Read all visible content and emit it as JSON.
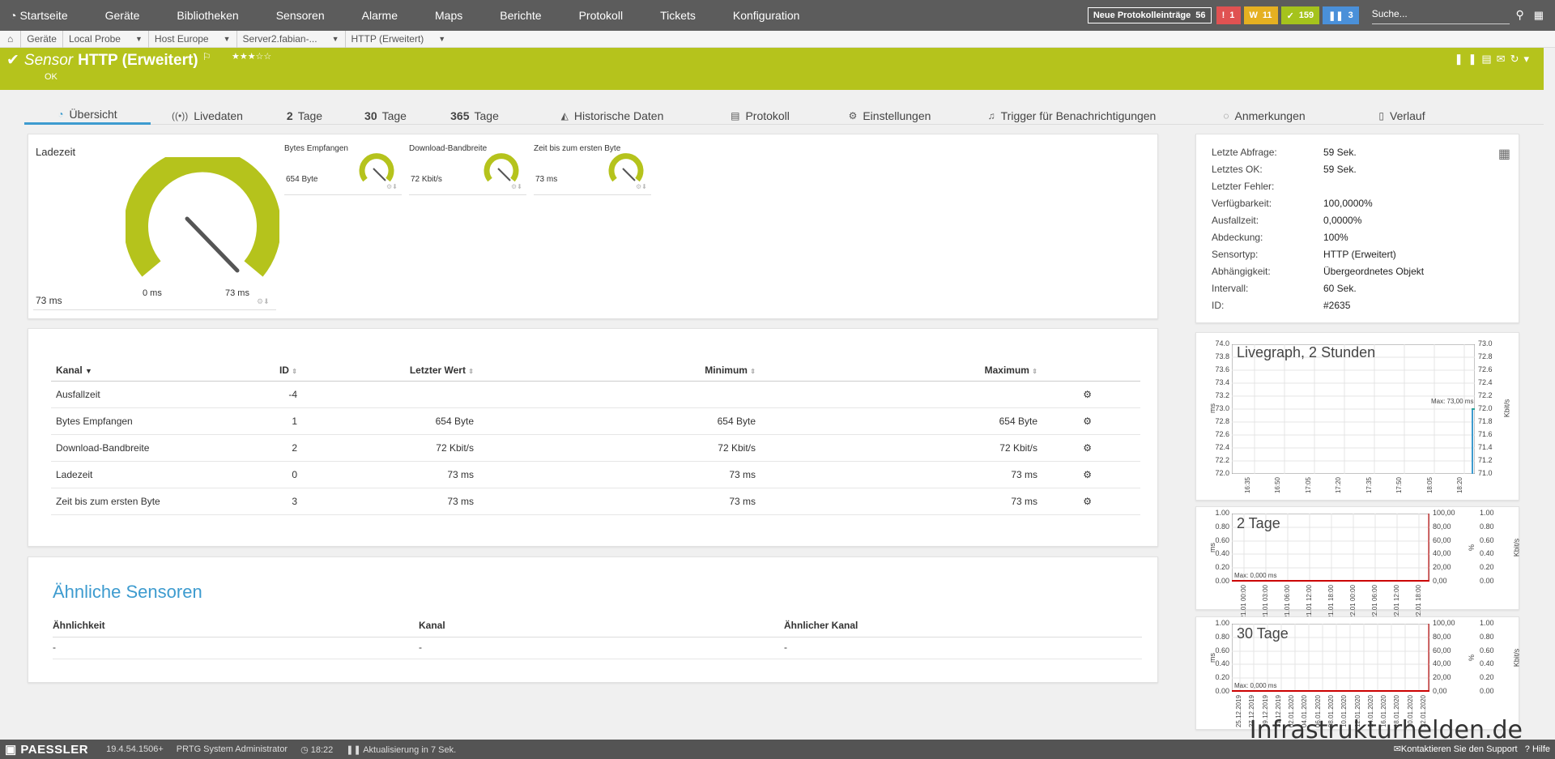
{
  "nav": {
    "items": [
      "Startseite",
      "Geräte",
      "Bibliotheken",
      "Sensoren",
      "Alarme",
      "Maps",
      "Berichte",
      "Protokoll",
      "Tickets",
      "Konfiguration"
    ],
    "new_log_label": "Neue Protokolleinträge",
    "new_log_count": "56",
    "badge_red": "1",
    "badge_yellow": "11",
    "badge_green": "159",
    "badge_blue": "3",
    "search_placeholder": "Suche..."
  },
  "breadcrumb": [
    "Geräte",
    "Local Probe",
    "Host Europe",
    "Server2.fabian-...",
    "HTTP (Erweitert)"
  ],
  "sensor": {
    "prefix": "Sensor",
    "name": "HTTP (Erweitert)",
    "status": "OK",
    "stars": "★★★☆☆"
  },
  "tabs": [
    {
      "num": "",
      "label": "Übersicht",
      "icon": "overview-icon"
    },
    {
      "num": "",
      "label": "Livedaten",
      "icon": "live-icon"
    },
    {
      "num": "2",
      "label": "Tage",
      "icon": ""
    },
    {
      "num": "30",
      "label": "Tage",
      "icon": ""
    },
    {
      "num": "365",
      "label": "Tage",
      "icon": ""
    },
    {
      "num": "",
      "label": "Historische Daten",
      "icon": "history-icon"
    },
    {
      "num": "",
      "label": "Protokoll",
      "icon": "log-icon"
    },
    {
      "num": "",
      "label": "Einstellungen",
      "icon": "gear-icon"
    },
    {
      "num": "",
      "label": "Trigger für Benachrichtigungen",
      "icon": "bell-icon"
    },
    {
      "num": "",
      "label": "Anmerkungen",
      "icon": "comment-icon"
    },
    {
      "num": "",
      "label": "Verlauf",
      "icon": "history-doc-icon"
    }
  ],
  "gauges": {
    "main": {
      "title": "Ladezeit",
      "value": "73 ms",
      "min": "0 ms",
      "max": "73 ms"
    },
    "mini": [
      {
        "title": "Bytes Empfangen",
        "value": "654 Byte"
      },
      {
        "title": "Download-Bandbreite",
        "value": "72 Kbit/s"
      },
      {
        "title": "Zeit bis zum ersten Byte",
        "value": "73 ms"
      }
    ]
  },
  "channels": {
    "headers": [
      "Kanal",
      "ID",
      "Letzter Wert",
      "Minimum",
      "Maximum"
    ],
    "rows": [
      {
        "name": "Ausfallzeit",
        "id": "-4",
        "last": "",
        "min": "",
        "max": ""
      },
      {
        "name": "Bytes Empfangen",
        "id": "1",
        "last": "654 Byte",
        "min": "654 Byte",
        "max": "654 Byte"
      },
      {
        "name": "Download-Bandbreite",
        "id": "2",
        "last": "72 Kbit/s",
        "min": "72 Kbit/s",
        "max": "72 Kbit/s"
      },
      {
        "name": "Ladezeit",
        "id": "0",
        "last": "73 ms",
        "min": "73 ms",
        "max": "73 ms"
      },
      {
        "name": "Zeit bis zum ersten Byte",
        "id": "3",
        "last": "73 ms",
        "min": "73 ms",
        "max": "73 ms"
      }
    ]
  },
  "similar": {
    "title": "Ähnliche Sensoren",
    "headers": [
      "Ähnlichkeit",
      "Kanal",
      "Ähnlicher Kanal"
    ],
    "row": [
      "-",
      "-",
      "-"
    ]
  },
  "details": [
    {
      "k": "Letzte Abfrage:",
      "v": "59 Sek."
    },
    {
      "k": "Letztes OK:",
      "v": "59 Sek."
    },
    {
      "k": "Letzter Fehler:",
      "v": ""
    },
    {
      "k": "Verfügbarkeit:",
      "v": "100,0000%"
    },
    {
      "k": "Ausfallzeit:",
      "v": "0,0000%"
    },
    {
      "k": "Abdeckung:",
      "v": "100%"
    },
    {
      "k": "Sensortyp:",
      "v": "HTTP (Erweitert)"
    },
    {
      "k": "Abhängigkeit:",
      "v": "Übergeordnetes Objekt"
    },
    {
      "k": "Intervall:",
      "v": "60 Sek."
    },
    {
      "k": "ID:",
      "v": "#2635"
    }
  ],
  "graphs": {
    "live": {
      "title": "Livegraph, 2 Stunden",
      "y_left": [
        "74.0",
        "73.8",
        "73.6",
        "73.4",
        "73.2",
        "73.0",
        "72.8",
        "72.6",
        "72.4",
        "72.2",
        "72.0"
      ],
      "y_right": [
        "73.0",
        "72.8",
        "72.6",
        "72.4",
        "72.2",
        "72.0",
        "71.8",
        "71.6",
        "71.4",
        "71.2",
        "71.0"
      ],
      "x": [
        "16:35",
        "16:50",
        "17:05",
        "17:20",
        "17:35",
        "17:50",
        "18:05",
        "18:20"
      ],
      "unit_left": "ms",
      "unit_right": "Kbit/s",
      "max_label": "Max: 73,00 ms"
    },
    "days2": {
      "title": "2 Tage",
      "y_left": [
        "1.00",
        "0.80",
        "0.60",
        "0.40",
        "0.20",
        "0.00"
      ],
      "y_mid": [
        "100,00",
        "80,00",
        "60,00",
        "40,00",
        "20,00",
        "0,00"
      ],
      "y_right": [
        "1.00",
        "0.80",
        "0.60",
        "0.40",
        "0.20",
        "0.00"
      ],
      "x": [
        "21.01 00:00",
        "21.01 03:00",
        "21.01 06:00",
        "21.01 12:00",
        "21.01 18:00",
        "22.01 00:00",
        "22.01 06:00",
        "22.01 12:00",
        "22.01 18:00"
      ],
      "unit_left": "ms",
      "unit_mid": "%",
      "unit_right": "Kbit/s",
      "max_label": "Max: 0,000 ms"
    },
    "days30": {
      "title": "30 Tage",
      "y_left": [
        "1.00",
        "0.80",
        "0.60",
        "0.40",
        "0.20",
        "0.00"
      ],
      "y_mid": [
        "100,00",
        "80,00",
        "60,00",
        "40,00",
        "20,00",
        "0,00"
      ],
      "y_right": [
        "1.00",
        "0.80",
        "0.60",
        "0.40",
        "0.20",
        "0.00"
      ],
      "x": [
        "25.12.2019",
        "27.12.2019",
        "29.12.2019",
        "31.12.2019",
        "02.01.2020",
        "04.01.2020",
        "06.01.2020",
        "08.01.2020",
        "10.01.2020",
        "12.01.2020",
        "14.01.2020",
        "16.01.2020",
        "18.01.2020",
        "20.01.2020",
        "22.01.2020"
      ],
      "unit_left": "ms",
      "unit_mid": "%",
      "unit_right": "Kbit/s",
      "max_label": "Max: 0,000 ms"
    }
  },
  "footer": {
    "brand": "PAESSLER",
    "version": "19.4.54.1506+",
    "user": "PRTG System Administrator",
    "time": "18:22",
    "refresh": "Aktualisierung in 7 Sek.",
    "support": "Kontaktieren Sie den Support",
    "help": "Hilfe"
  },
  "watermark": "Infrastrukturhelden.de",
  "colors": {
    "accent": "#b5c31c",
    "link": "#3d9bcf",
    "nav": "#5c5c5c"
  }
}
